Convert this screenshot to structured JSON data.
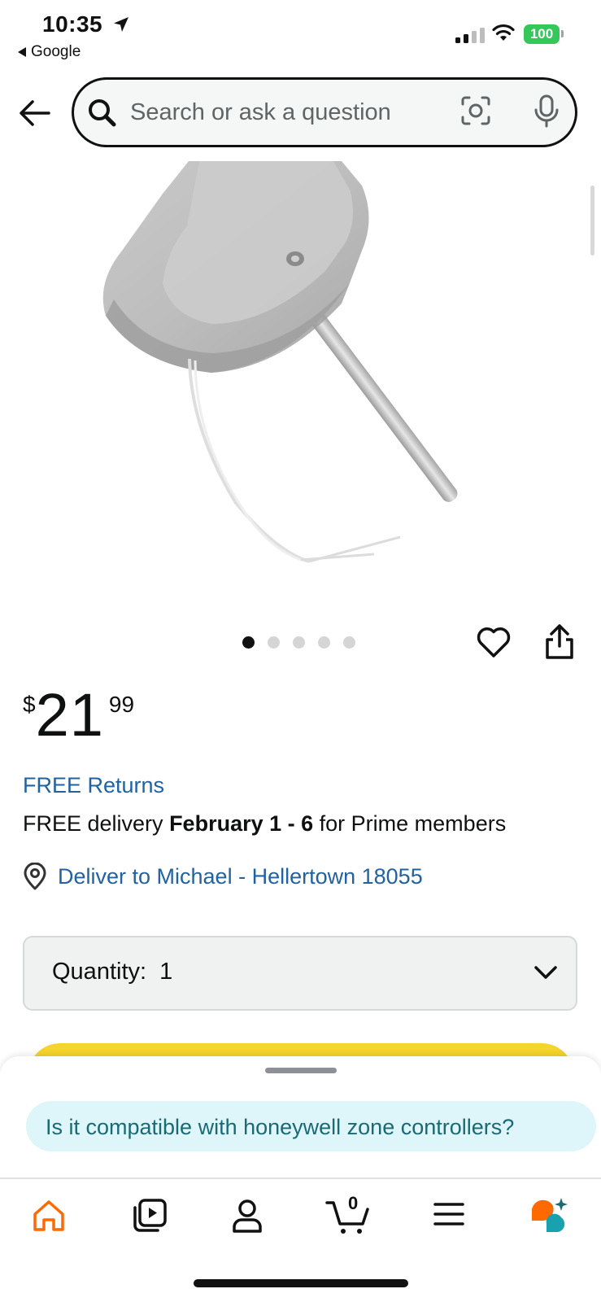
{
  "status_bar": {
    "time": "10:35",
    "back_app": "Google",
    "battery": "100"
  },
  "search": {
    "placeholder": "Search or ask a question"
  },
  "product": {
    "image_dots": 5,
    "active_dot": 0,
    "price": {
      "currency": "$",
      "whole": "21",
      "fraction": "99"
    },
    "free_returns": "FREE Returns",
    "delivery": {
      "prefix": "FREE delivery",
      "dates": "February 1 - 6",
      "suffix": "for Prime members"
    },
    "deliver_to": "Deliver to Michael - Hellertown 18055",
    "quantity": {
      "label": "Quantity:",
      "value": "1"
    }
  },
  "sheet": {
    "suggested_question": "Is it compatible with honeywell zone controllers?"
  },
  "nav": {
    "items": [
      "home-icon",
      "video-icon",
      "account-icon",
      "cart-icon",
      "menu-icon",
      "rufus-icon"
    ],
    "cart_count": "0"
  },
  "colors": {
    "link": "#2162a1",
    "accent_orange": "#ff6a00",
    "buy_button": "#f5d42b",
    "battery": "#34c759",
    "chip_bg": "#def6f9"
  }
}
